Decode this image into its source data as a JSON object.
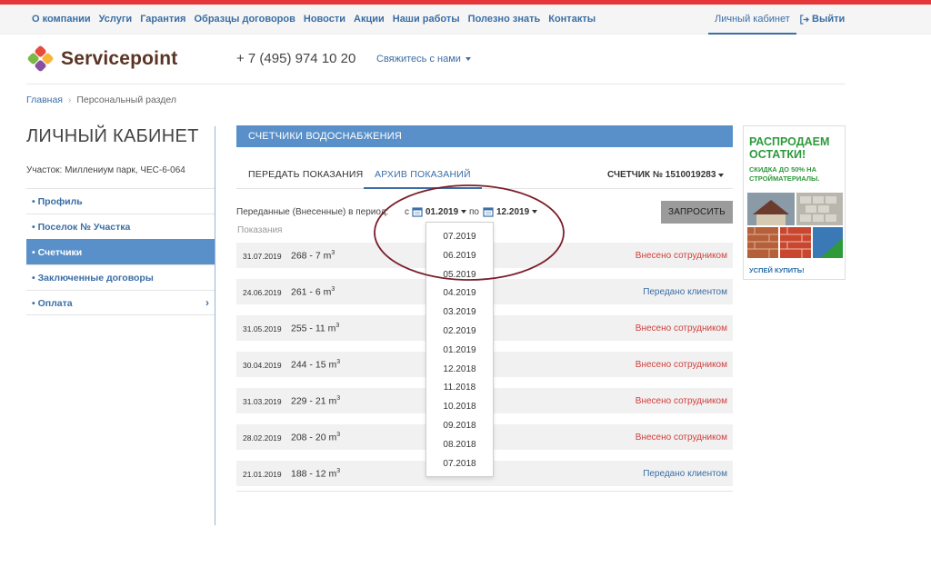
{
  "top_menu": [
    "О компании",
    "Услуги",
    "Гарантия",
    "Образцы договоров",
    "Новости",
    "Акции",
    "Наши работы",
    "Полезно знать",
    "Контакты"
  ],
  "top_right": {
    "cabinet": "Личный кабинет",
    "logout": "Выйти"
  },
  "header": {
    "brand": "Servicepoint",
    "phone": "+ 7 (495) 974 10 20",
    "contact": "Свяжитесь с нами"
  },
  "breadcrumb": {
    "home": "Главная",
    "current": "Персональный раздел"
  },
  "sidebar": {
    "title": "ЛИЧНЫЙ КАБИНЕТ",
    "plot": "Участок: Миллениум парк, ЧЕС-6-064",
    "items": [
      "• Профиль",
      "• Поселок № Участка",
      "• Счетчики",
      "• Заключенные договоры",
      "• Оплата"
    ],
    "active_index": 2
  },
  "main": {
    "section_title": "СЧЕТЧИКИ ВОДОСНАБЖЕНИЯ",
    "tabs": [
      "ПЕРЕДАТЬ ПОКАЗАНИЯ",
      "АРХИВ ПОКАЗАНИЙ"
    ],
    "active_tab": 1,
    "meter": "СЧЕТЧИК № 1510019283",
    "period_label": "Переданные (Внесенные) в период:",
    "from_label": "с",
    "from_value": "01.2019",
    "to_label": "по",
    "to_value": "12.2019",
    "query_button": "ЗАПРОСИТЬ",
    "readings_label": "Показания",
    "rows": [
      {
        "date": "31.07.2019",
        "value": "268 - 7 m",
        "status": "Внесено сотрудником",
        "kind": "emp"
      },
      {
        "date": "24.06.2019",
        "value": "261 - 6 m",
        "status": "Передано клиентом",
        "kind": "cli"
      },
      {
        "date": "31.05.2019",
        "value": "255 - 11 m",
        "status": "Внесено сотрудником",
        "kind": "emp"
      },
      {
        "date": "30.04.2019",
        "value": "244 - 15 m",
        "status": "Внесено сотрудником",
        "kind": "emp"
      },
      {
        "date": "31.03.2019",
        "value": "229 - 21 m",
        "status": "Внесено сотрудником",
        "kind": "emp"
      },
      {
        "date": "28.02.2019",
        "value": "208 - 20 m",
        "status": "Внесено сотрудником",
        "kind": "emp"
      },
      {
        "date": "21.01.2019",
        "value": "188 - 12 m",
        "status": "Передано клиентом",
        "kind": "cli"
      }
    ],
    "unit_sup": "3"
  },
  "date_dropdown": [
    "07.2019",
    "06.2019",
    "05.2019",
    "04.2019",
    "03.2019",
    "02.2019",
    "01.2019",
    "12.2018",
    "11.2018",
    "10.2018",
    "09.2018",
    "08.2018",
    "07.2018"
  ],
  "ad": {
    "headline": "РАСПРОДАЕМ ОСТАТКИ!",
    "sub": "СКИДКА ДО 50% НА СТРОЙМАТЕРИАЛЫ.",
    "cta": "УСПЕЙ КУПИТЬ!"
  },
  "colors": {
    "accent_red": "#e5373a",
    "link_blue": "#3a6ea5",
    "header_blue": "#5990c9",
    "annotation": "#7a1f2b"
  }
}
